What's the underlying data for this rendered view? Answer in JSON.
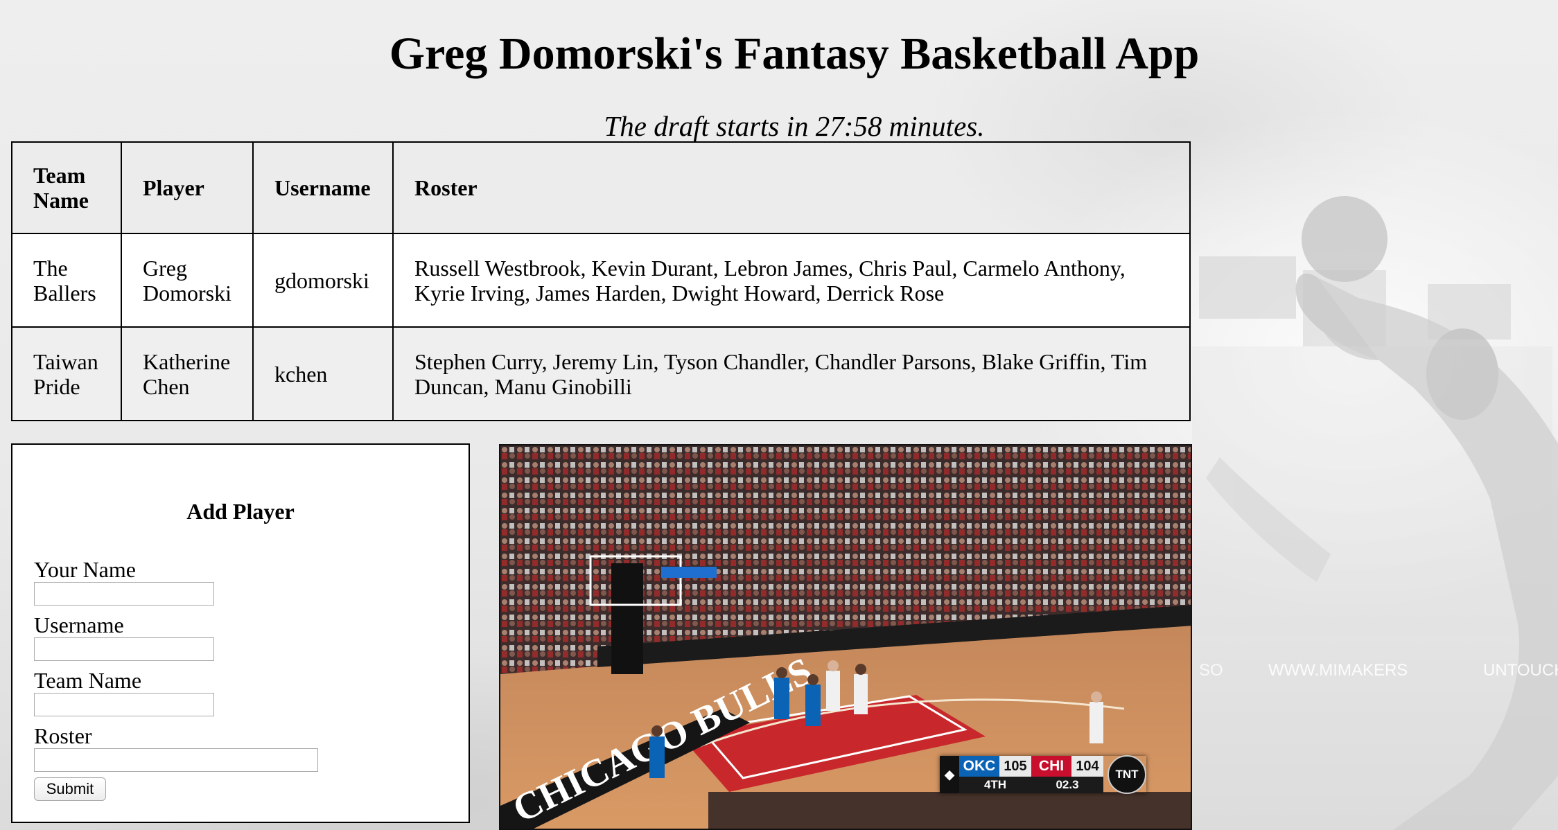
{
  "page": {
    "title": "Greg Domorski's Fantasy Basketball App",
    "countdown": "The draft starts in 27:58 minutes."
  },
  "table": {
    "headers": [
      "Team Name",
      "Player",
      "Username",
      "Roster"
    ],
    "rows": [
      {
        "team": "The Ballers",
        "player": "Greg Domorski",
        "username": "gdomorski",
        "roster": "Russell Westbrook, Kevin Durant, Lebron James, Chris Paul, Carmelo Anthony, Kyrie Irving, James Harden, Dwight Howard, Derrick Rose"
      },
      {
        "team": "Taiwan Pride",
        "player": "Katherine Chen",
        "username": "kchen",
        "roster": "Stephen Curry, Jeremy Lin, Tyson Chandler, Chandler Parsons, Blake Griffin, Tim Duncan, Manu Ginobilli"
      }
    ]
  },
  "form": {
    "title": "Add Player",
    "fields": [
      {
        "label": "Your Name",
        "value": ""
      },
      {
        "label": "Username",
        "value": ""
      },
      {
        "label": "Team Name",
        "value": ""
      },
      {
        "label": "Roster",
        "value": ""
      }
    ],
    "submit_label": "Submit"
  },
  "video": {
    "court_text": "CHICAGO BULLS",
    "scorebug": {
      "away_team": "OKC",
      "away_score": "105",
      "home_team": "CHI",
      "home_score": "104",
      "quarter": "4TH",
      "clock": "02.3",
      "network": "TNT",
      "away_color": "#0b63b5",
      "home_color": "#c8102e"
    }
  },
  "background": {
    "watermark": "WWW.MIMAKERS"
  },
  "colors": {
    "page_background": "#ececec",
    "row_alt": "#efefef"
  }
}
